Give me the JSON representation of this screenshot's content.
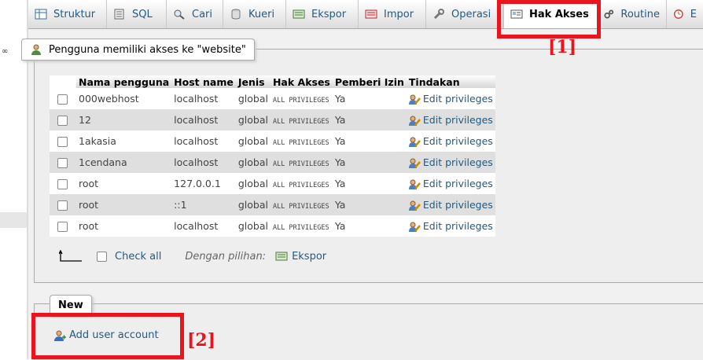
{
  "tabs": [
    {
      "label": "Struktur",
      "icon": "table-structure-icon"
    },
    {
      "label": "SQL",
      "icon": "sql-icon"
    },
    {
      "label": "Cari",
      "icon": "search-icon"
    },
    {
      "label": "Kueri",
      "icon": "query-icon"
    },
    {
      "label": "Ekspor",
      "icon": "export-icon"
    },
    {
      "label": "Impor",
      "icon": "import-icon"
    },
    {
      "label": "Operasi",
      "icon": "wrench-icon"
    },
    {
      "label": "Hak Akses",
      "icon": "privileges-icon"
    },
    {
      "label": "Routine",
      "icon": "routine-icon"
    },
    {
      "label": "E",
      "icon": "event-icon"
    }
  ],
  "panel": {
    "legend": "Pengguna memiliki akses ke \"website\"",
    "columns": [
      "Nama pengguna",
      "Host name",
      "Jenis",
      "Hak Akses",
      "Pemberi Izin",
      "Tindakan"
    ],
    "rows": [
      {
        "user": "000webhost",
        "host": "localhost",
        "type": "global",
        "privs": "ALL PRIVILEGES",
        "grant": "Ya",
        "action": "Edit privileges"
      },
      {
        "user": "12",
        "host": "localhost",
        "type": "global",
        "privs": "ALL PRIVILEGES",
        "grant": "Ya",
        "action": "Edit privileges"
      },
      {
        "user": "1akasia",
        "host": "localhost",
        "type": "global",
        "privs": "ALL PRIVILEGES",
        "grant": "Ya",
        "action": "Edit privileges"
      },
      {
        "user": "1cendana",
        "host": "localhost",
        "type": "global",
        "privs": "ALL PRIVILEGES",
        "grant": "Ya",
        "action": "Edit privileges"
      },
      {
        "user": "root",
        "host": "127.0.0.1",
        "type": "global",
        "privs": "ALL PRIVILEGES",
        "grant": "Ya",
        "action": "Edit privileges"
      },
      {
        "user": "root",
        "host": "::1",
        "type": "global",
        "privs": "ALL PRIVILEGES",
        "grant": "Ya",
        "action": "Edit privileges"
      },
      {
        "user": "root",
        "host": "localhost",
        "type": "global",
        "privs": "ALL PRIVILEGES",
        "grant": "Ya",
        "action": "Edit privileges"
      }
    ],
    "check_all": "Check all",
    "with_selected": "Dengan pilihan:",
    "export": "Ekspor"
  },
  "new_panel": {
    "legend": "New",
    "add_user": "Add user account"
  },
  "annotations": {
    "label1": "[1]",
    "label2": "[2]"
  },
  "colors": {
    "annotation": "#e8141e",
    "link": "#235a81"
  }
}
